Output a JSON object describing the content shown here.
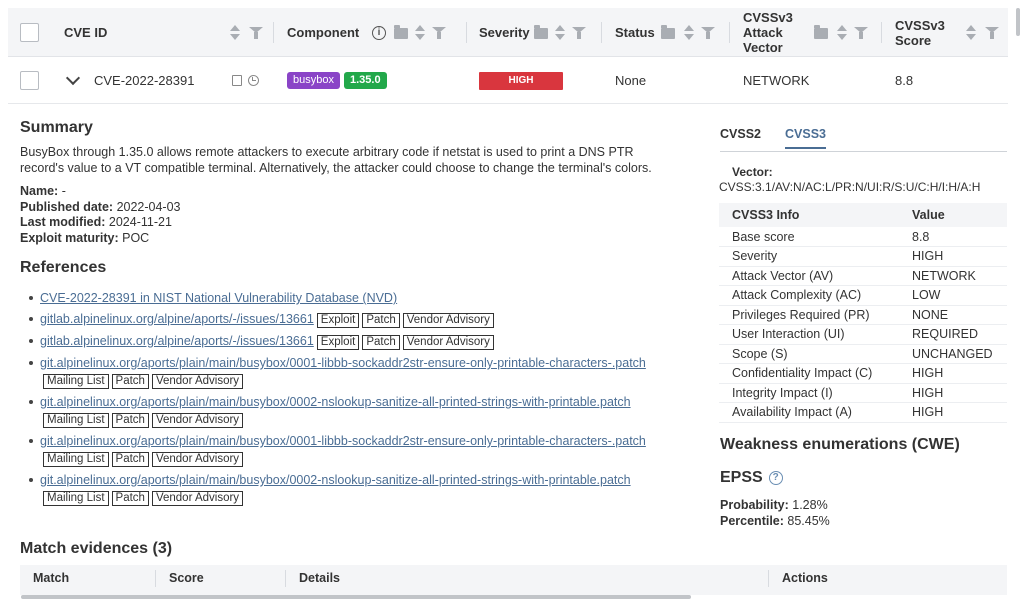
{
  "header": {
    "cve_id": "CVE ID",
    "component": "Component",
    "severity": "Severity",
    "status": "Status",
    "attack_vector": "CVSSv3 Attack Vector",
    "score": "CVSSv3 Score"
  },
  "row": {
    "cve_id": "CVE-2022-28391",
    "component": "busybox",
    "version": "1.35.0",
    "severity": "HIGH",
    "status": "None",
    "attack_vector": "NETWORK",
    "score": "8.8"
  },
  "summary": {
    "title": "Summary",
    "text": "BusyBox through 1.35.0 allows remote attackers to execute arbitrary code if netstat is used to print a DNS PTR record's value to a VT compatible terminal. Alternatively, the attacker could choose to change the terminal's colors.",
    "name_label": "Name:",
    "name_value": "-",
    "published_label": "Published date:",
    "published_value": "2022-04-03",
    "modified_label": "Last modified:",
    "modified_value": "2024-11-21",
    "exploit_label": "Exploit maturity:",
    "exploit_value": "POC"
  },
  "references": {
    "title": "References",
    "items": [
      {
        "text": "CVE-2022-28391 in NIST National Vulnerability Database (NVD)",
        "tags": []
      },
      {
        "text": "gitlab.alpinelinux.org/alpine/aports/-/issues/13661",
        "tags": [
          "Exploit",
          "Patch",
          "Vendor Advisory"
        ]
      },
      {
        "text": "gitlab.alpinelinux.org/alpine/aports/-/issues/13661",
        "tags": [
          "Exploit",
          "Patch",
          "Vendor Advisory"
        ]
      },
      {
        "text": "git.alpinelinux.org/aports/plain/main/busybox/0001-libbb-sockaddr2str-ensure-only-printable-characters-.patch",
        "tags": [
          "Mailing List",
          "Patch",
          "Vendor Advisory"
        ]
      },
      {
        "text": "git.alpinelinux.org/aports/plain/main/busybox/0002-nslookup-sanitize-all-printed-strings-with-printable.patch",
        "tags": [
          "Mailing List",
          "Patch",
          "Vendor Advisory"
        ]
      },
      {
        "text": "git.alpinelinux.org/aports/plain/main/busybox/0001-libbb-sockaddr2str-ensure-only-printable-characters-.patch",
        "tags": [
          "Mailing List",
          "Patch",
          "Vendor Advisory"
        ]
      },
      {
        "text": "git.alpinelinux.org/aports/plain/main/busybox/0002-nslookup-sanitize-all-printed-strings-with-printable.patch",
        "tags": [
          "Mailing List",
          "Patch",
          "Vendor Advisory"
        ]
      }
    ]
  },
  "cvss": {
    "tab_v2": "CVSS2",
    "tab_v3": "CVSS3",
    "vector_label": "Vector:",
    "vector_value": "CVSS:3.1/AV:N/AC:L/PR:N/UI:R/S:U/C:H/I:H/A:H",
    "col_info": "CVSS3 Info",
    "col_value": "Value",
    "rows": [
      {
        "k": "Base score",
        "v": "8.8"
      },
      {
        "k": "Severity",
        "v": "HIGH"
      },
      {
        "k": "Attack Vector (AV)",
        "v": "NETWORK"
      },
      {
        "k": "Attack Complexity (AC)",
        "v": "LOW"
      },
      {
        "k": "Privileges Required (PR)",
        "v": "NONE"
      },
      {
        "k": "User Interaction (UI)",
        "v": "REQUIRED"
      },
      {
        "k": "Scope (S)",
        "v": "UNCHANGED"
      },
      {
        "k": "Confidentiality Impact (C)",
        "v": "HIGH"
      },
      {
        "k": "Integrity Impact (I)",
        "v": "HIGH"
      },
      {
        "k": "Availability Impact (A)",
        "v": "HIGH"
      }
    ]
  },
  "cwe": {
    "title": "Weakness enumerations (CWE)"
  },
  "epss": {
    "title": "EPSS",
    "prob_label": "Probability:",
    "prob_value": "1.28%",
    "pct_label": "Percentile:",
    "pct_value": "85.45%"
  },
  "match": {
    "title": "Match evidences (3)",
    "col_match": "Match",
    "col_score": "Score",
    "col_details": "Details",
    "col_actions": "Actions"
  }
}
